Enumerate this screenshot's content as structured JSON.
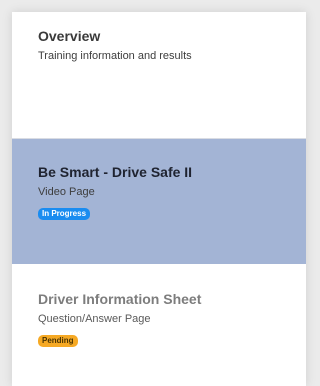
{
  "items": [
    {
      "title": "Overview",
      "subtitle": "Training information and results"
    },
    {
      "title": "Be Smart - Drive Safe II",
      "subtitle": "Video Page",
      "status": "In Progress",
      "status_color": "#1a8cf0",
      "selected": true,
      "highlight_color": "#a3b4d5"
    },
    {
      "title": "Driver Information Sheet",
      "subtitle": "Question/Answer Page",
      "status": "Pending",
      "status_color": "#f6a924"
    }
  ]
}
